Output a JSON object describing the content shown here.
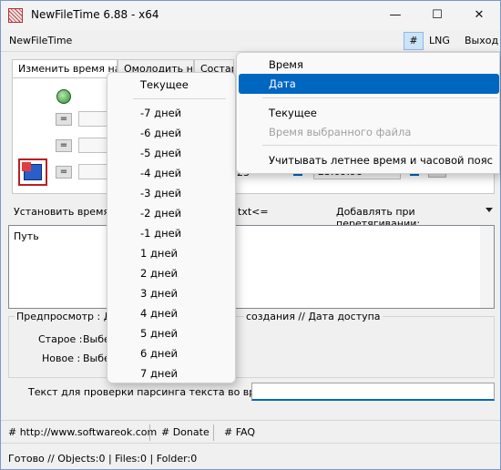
{
  "window": {
    "title": "NewFileTime 6.88 - x64",
    "minimize": "—",
    "maximize": "☐",
    "close": "✕"
  },
  "menubar": {
    "app": "NewFileTime",
    "hash": "#",
    "lng": "LNG",
    "exit": "Выход"
  },
  "tabs": [
    "Изменить время на",
    "Омолодить на",
    "Состар"
  ],
  "controls": {
    "set_time": "Установить время",
    "txt_filter": "txt<=",
    "add_on_drag": "Добавлять при перетягивании:",
    "eq": "=",
    "date_fragment": "23",
    "time_fragment": "23.09.98"
  },
  "list": {
    "header": "Путь"
  },
  "preview": {
    "label": "Предпросмотр",
    "colon": ":",
    "d_fragment": "Д",
    "created": "создания   //   Дата доступа",
    "old_label": "Старое :",
    "old_value": "Выбе",
    "new_label": "Новое :",
    "new_value": "Выбе"
  },
  "parse": {
    "label": "Текст для проверки парсинга текста во время",
    "value": ""
  },
  "links": [
    "# http://www.softwareok.com",
    "# Donate",
    "# FAQ"
  ],
  "status": "Готово // Objects:0 | Files:0  |  Folder:0",
  "popup_days": {
    "header": "Текущее",
    "items": [
      "-7 дней",
      "-6 дней",
      "-5 дней",
      "-4 дней",
      "-3 дней",
      "-2 дней",
      "-1 дней",
      "1 дней",
      "2 дней",
      "3 дней",
      "4 дней",
      "5 дней",
      "6 дней",
      "7 дней"
    ]
  },
  "popup_main": {
    "items": [
      "Время",
      "Дата",
      "Текущее",
      "Время выбранного файла",
      "Учитывать летнее время и часовой пояс"
    ],
    "highlighted": "Дата",
    "disabled": "Время выбранного файла"
  },
  "colors": {
    "accent": "#0067c0",
    "menu_hover": "#cce4f7"
  }
}
